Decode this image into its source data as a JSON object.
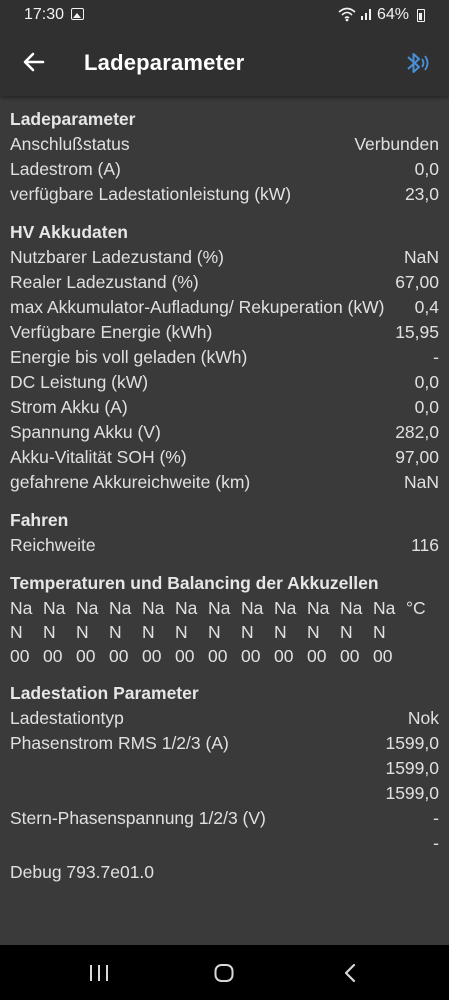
{
  "status_bar": {
    "time": "17:30",
    "battery": "64%",
    "icons": [
      "gallery-icon",
      "wifi-icon",
      "signal-icon",
      "battery-icon"
    ]
  },
  "app_bar": {
    "title": "Ladeparameter",
    "back_icon": "arrow-left-icon",
    "bluetooth_icon": "bluetooth-connected-icon",
    "bluetooth_color": "#4a90d9"
  },
  "sections": {
    "lade": {
      "title": "Ladeparameter",
      "rows": [
        {
          "label": "Anschlußstatus",
          "value": "Verbunden"
        },
        {
          "label": "Ladestrom (A)",
          "value": "0,0"
        },
        {
          "label": "verfügbare Ladestationleistung (kW)",
          "value": "23,0"
        }
      ]
    },
    "hv": {
      "title": "HV Akkudaten",
      "rows": [
        {
          "label": "Nutzbarer Ladezustand (%)",
          "value": "NaN"
        },
        {
          "label": "Realer Ladezustand (%)",
          "value": "67,00"
        },
        {
          "label": "max Akkumulator-Aufladung/ Rekuperation (kW)",
          "value": "0,4"
        },
        {
          "label": "Verfügbare Energie (kWh)",
          "value": "15,95"
        },
        {
          "label": "Energie bis voll geladen (kWh)",
          "value": "-"
        },
        {
          "label": "DC Leistung (kW)",
          "value": "0,0"
        },
        {
          "label": "Strom Akku (A)",
          "value": "0,0"
        },
        {
          "label": "Spannung Akku (V)",
          "value": "282,0"
        },
        {
          "label": "Akku-Vitalität SOH (%)",
          "value": "97,00"
        },
        {
          "label": "gefahrene Akkureichweite (km)",
          "value": "NaN"
        }
      ]
    },
    "fahren": {
      "title": "Fahren",
      "rows": [
        {
          "label": "Reichweite",
          "value": "116"
        }
      ]
    },
    "temp": {
      "title": "Temperaturen und Balancing der Akkuzellen",
      "cells": [
        "Na\nN\n00",
        "Na\nN\n00",
        "Na\nN\n00",
        "Na\nN\n00",
        "Na\nN\n00",
        "Na\nN\n00",
        "Na\nN\n00",
        "Na\nN\n00",
        "Na\nN\n00",
        "Na\nN\n00",
        "Na\nN\n00",
        "Na\nN\n00"
      ],
      "unit": "°C"
    },
    "station": {
      "title": "Ladestation Parameter",
      "rows": [
        {
          "label": "Ladestationtyp",
          "value": "Nok"
        },
        {
          "label": "Phasenstrom RMS 1/2/3 (A)",
          "value": "1599,0"
        },
        {
          "label": "",
          "value": "1599,0"
        },
        {
          "label": "",
          "value": "1599,0"
        },
        {
          "label": "Stern-Phasenspannung 1/2/3 (V)",
          "value": "-"
        },
        {
          "label": "",
          "value": "-"
        }
      ]
    }
  },
  "debug": "Debug 793.7e01.0",
  "nav_bar": {
    "icons": [
      "recents-icon",
      "home-icon",
      "back-icon"
    ]
  }
}
